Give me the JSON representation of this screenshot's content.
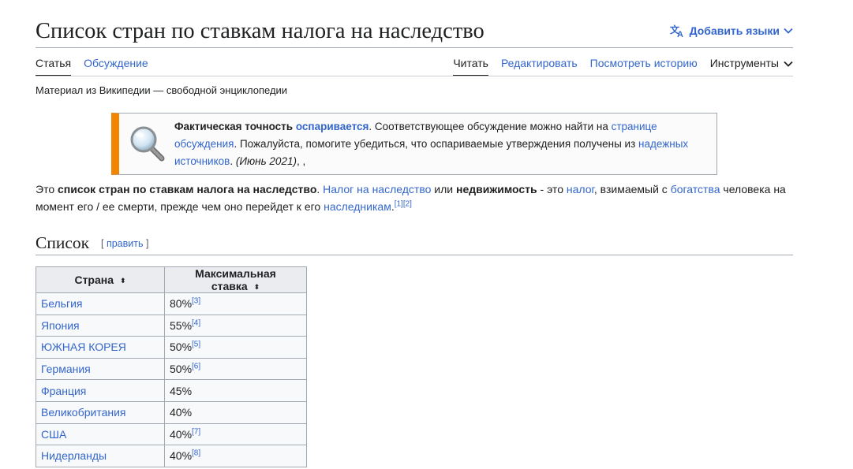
{
  "header": {
    "title": "Список стран по ставкам налога на наследство",
    "add_languages": "Добавить языки"
  },
  "tabs": {
    "left": [
      {
        "label": "Статья",
        "selected": true
      },
      {
        "label": "Обсуждение"
      }
    ],
    "right": [
      {
        "label": "Читать",
        "selected": true
      },
      {
        "label": "Редактировать"
      },
      {
        "label": "Посмотреть историю"
      },
      {
        "label": "Инструменты"
      }
    ]
  },
  "tagline": "Материал из Википедии — свободной энциклопедии",
  "notice": {
    "bold_prefix": "Фактическая точность",
    "disputed_link": "оспаривается",
    "text1": ". Соответствующее обсуждение можно найти на ",
    "talk_link": "странице обсуждения",
    "text2": ". Пожалуйста, помогите убедиться, что оспариваемые утверждения получены из ",
    "sources_link": "надежных источников",
    "text3": ".",
    "date": "(Июнь 2021)",
    "trail": ", ,"
  },
  "intro": {
    "t1": "Это ",
    "b1": "список стран по ставкам налога на наследство",
    "t2": ". ",
    "link1": "Налог на наследство",
    "t3": " или ",
    "b2": "недвижимость",
    "t4": " - это ",
    "link2": "налог",
    "t5": ", взимаемый с ",
    "link3": "богатства",
    "t6": " человека на момент его / ее смерти, прежде чем оно перейдет к его ",
    "link4": "наследникам",
    "t7": ".",
    "ref1": "[1]",
    "ref2": "[2]"
  },
  "section": {
    "title": "Список",
    "edit_open": "[ ",
    "edit_label": "править",
    "edit_close": " ]"
  },
  "table": {
    "headers": [
      "Страна",
      "Максимальная ставка"
    ],
    "sort_icon": "⬍",
    "rows": [
      {
        "country": "Бельгия",
        "rate": "80%",
        "ref": "[3]"
      },
      {
        "country": "Япония",
        "rate": "55%",
        "ref": "[4]"
      },
      {
        "country": "ЮЖНАЯ КОРЕЯ",
        "rate": "50%",
        "ref": "[5]"
      },
      {
        "country": "Германия",
        "rate": "50%",
        "ref": "[6]"
      },
      {
        "country": "Франция",
        "rate": "45%",
        "ref": ""
      },
      {
        "country": "Великобритания",
        "rate": "40%",
        "ref": ""
      },
      {
        "country": "США",
        "rate": "40%",
        "ref": "[7]"
      },
      {
        "country": "Нидерланды",
        "rate": "40%",
        "ref": "[8]"
      }
    ]
  },
  "colors": {
    "link": "#3366cc",
    "text": "#202122",
    "notice_stripe": "#f28500",
    "table_header_bg": "#eaecf0",
    "table_bg": "#f8f9fa"
  },
  "icons": {
    "language": "translate-icon",
    "chevron": "chevron-down-icon",
    "notice": "magnifier-icon"
  }
}
